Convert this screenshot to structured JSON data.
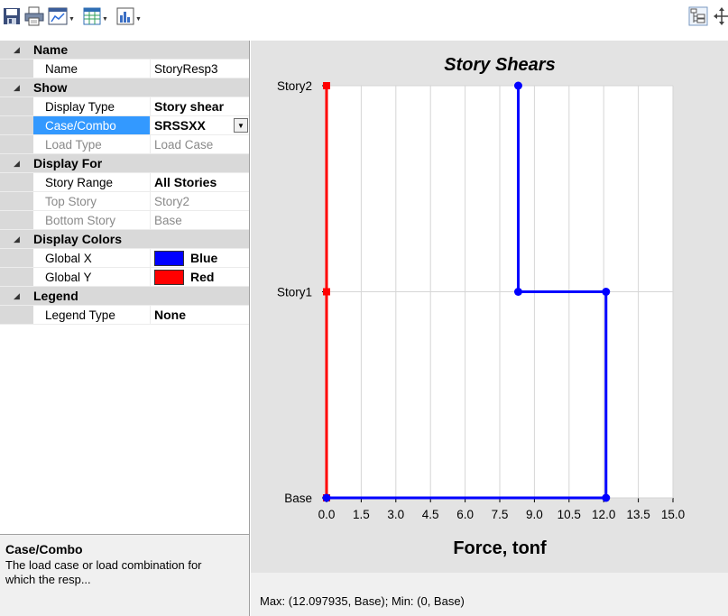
{
  "toolbar": {
    "buttons": [
      {
        "icon": "save-icon"
      },
      {
        "icon": "print-icon"
      },
      {
        "icon": "chart-view-icon"
      },
      {
        "icon": "table-icon"
      },
      {
        "icon": "bar-chart-icon"
      },
      {
        "icon": "tree-view-icon"
      },
      {
        "icon": "move-icon"
      }
    ]
  },
  "properties": {
    "categories": {
      "name": "Name",
      "show": "Show",
      "display_for": "Display For",
      "display_colors": "Display Colors",
      "legend": "Legend"
    },
    "rows": {
      "name": {
        "key": "Name",
        "value": "StoryResp3"
      },
      "display_type": {
        "key": "Display Type",
        "value": "Story shear"
      },
      "case_combo": {
        "key": "Case/Combo",
        "value": "SRSSXX"
      },
      "load_type": {
        "key": "Load Type",
        "value": "Load Case"
      },
      "story_range": {
        "key": "Story Range",
        "value": "All Stories"
      },
      "top_story": {
        "key": "Top Story",
        "value": "Story2"
      },
      "bottom_story": {
        "key": "Bottom Story",
        "value": "Base"
      },
      "global_x": {
        "key": "Global X",
        "value": "Blue",
        "color": "#0000ff"
      },
      "global_y": {
        "key": "Global Y",
        "value": "Red",
        "color": "#ff0000"
      },
      "legend_type": {
        "key": "Legend Type",
        "value": "None"
      }
    }
  },
  "help": {
    "title": "Case/Combo",
    "description": "The load case or load combination for which the resp..."
  },
  "chart_data": {
    "type": "line",
    "title": "Story Shears",
    "xlabel": "Force, tonf",
    "ylabel": "",
    "categories": [
      "Base",
      "Story1",
      "Story2"
    ],
    "x_ticks": [
      "0.0",
      "1.5",
      "3.0",
      "4.5",
      "6.0",
      "7.5",
      "9.0",
      "10.5",
      "12.0",
      "13.5",
      "15.0"
    ],
    "xlim": [
      0,
      15
    ],
    "grid": true,
    "series": [
      {
        "color": "#ff0000",
        "points": [
          {
            "story": "Base",
            "x": 0
          },
          {
            "story": "Story1",
            "x": 0
          },
          {
            "story": "Story2",
            "x": 0
          }
        ]
      },
      {
        "color": "#0000ff",
        "points": [
          {
            "story": "Base",
            "x": 0
          },
          {
            "story": "Base",
            "x": 12.1
          },
          {
            "story": "Story1",
            "x": 12.1
          },
          {
            "story": "Story1",
            "x": 8.3
          },
          {
            "story": "Story2",
            "x": 8.3
          }
        ]
      }
    ]
  },
  "status": {
    "text": "Max: (12.097935, Base);   Min: (0, Base)"
  }
}
